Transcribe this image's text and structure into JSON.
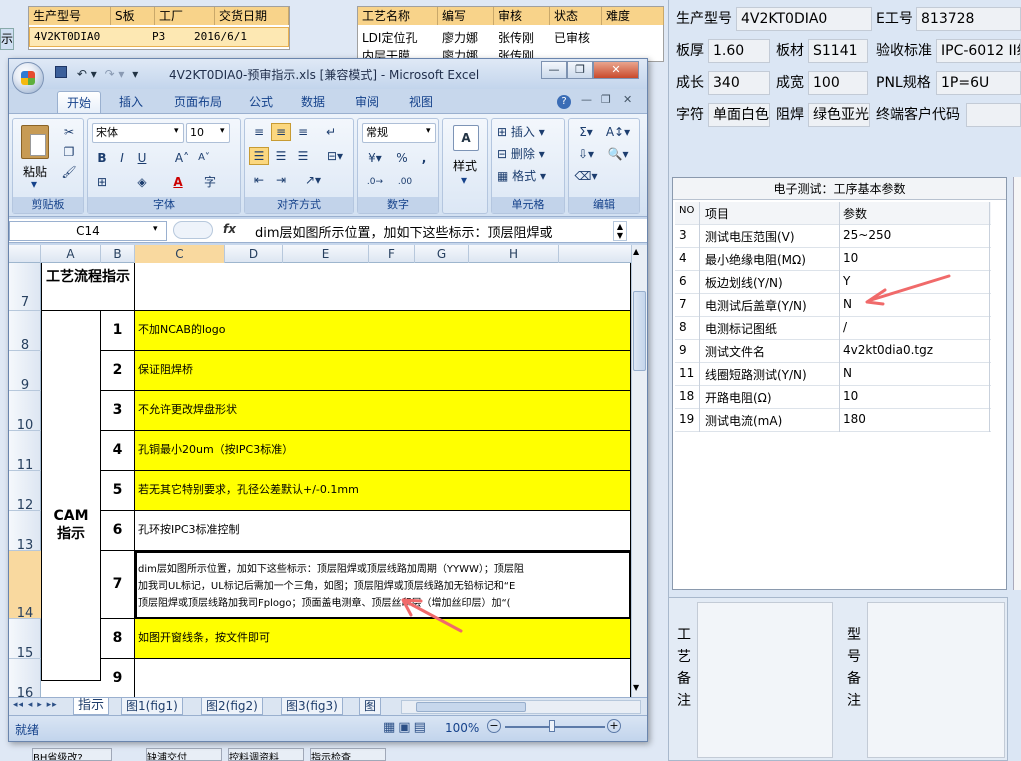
{
  "bg": {
    "left_table": {
      "headers": [
        "生产型号",
        "S板",
        "工厂",
        "交货日期"
      ],
      "row": [
        "4V2KT0DIA0",
        "P3",
        "2016/6/1"
      ]
    },
    "right_table": {
      "headers": [
        "工艺名称",
        "编写",
        "审核",
        "状态",
        "难度"
      ],
      "row": [
        "LDI定位孔",
        "廖力娜",
        "张传刚",
        "已审核"
      ],
      "row2_partial": [
        "内层干膜",
        "廖力娜",
        "张传刚"
      ]
    },
    "left_edge_text": "示",
    "bottom_buttons": [
      "BH省级改?",
      "缺浦交付",
      "控料调资料",
      "指示检查"
    ]
  },
  "panel": {
    "fields": [
      {
        "label": "生产型号",
        "value": "4V2KT0DIA0"
      },
      {
        "label": "E工号",
        "value": "813728"
      },
      {
        "label": "板厚",
        "value": "1.60"
      },
      {
        "label": "板材",
        "value": "S1141"
      },
      {
        "label": "验收标准",
        "value": "IPC-6012 II级"
      },
      {
        "label": "成长",
        "value": "340"
      },
      {
        "label": "成宽",
        "value": "100"
      },
      {
        "label": "PNL规格",
        "value": "1P=6U"
      },
      {
        "label": "字符",
        "value": "单面白色"
      },
      {
        "label": "阻焊",
        "value": "绿色亚光"
      },
      {
        "label": "终端客户代码",
        "value": ""
      }
    ],
    "params": {
      "title": "电子测试：工序基本参数",
      "headers": [
        "NO",
        "项目",
        "参数"
      ],
      "rows": [
        {
          "no": "3",
          "item": "测试电压范围(V)",
          "value": "25~250"
        },
        {
          "no": "4",
          "item": "最小绝缘电阻(MΩ)",
          "value": "10"
        },
        {
          "no": "6",
          "item": "板边划线(Y/N)",
          "value": "Y"
        },
        {
          "no": "7",
          "item": "电测试后盖章(Y/N)",
          "value": "N"
        },
        {
          "no": "8",
          "item": "电测标记图纸",
          "value": "/"
        },
        {
          "no": "9",
          "item": "测试文件名",
          "value": "4v2kt0dia0.tgz"
        },
        {
          "no": "11",
          "item": "线圈短路测试(Y/N)",
          "value": "N"
        },
        {
          "no": "18",
          "item": "开路电阻(Ω)",
          "value": "10"
        },
        {
          "no": "19",
          "item": "测试电流(mA)",
          "value": "180"
        }
      ]
    },
    "notes": {
      "left_label": "工艺备注",
      "right_label": "型号备注"
    }
  },
  "excel": {
    "title": "4V2KT0DIA0-预审指示.xls [兼容模式] - Microsoft Excel",
    "tabs": [
      "开始",
      "插入",
      "页面布局",
      "公式",
      "数据",
      "审阅",
      "视图"
    ],
    "active_tab": "开始",
    "ribbon": {
      "clipboard": {
        "label": "剪贴板",
        "paste": "粘贴"
      },
      "font": {
        "label": "字体",
        "name": "宋体",
        "size": "10"
      },
      "align": {
        "label": "对齐方式"
      },
      "number": {
        "label": "数字",
        "format": "常规"
      },
      "style": {
        "label": "样式"
      },
      "cells": {
        "label": "单元格",
        "insert": "插入",
        "delete": "删除",
        "format": "格式"
      },
      "edit": {
        "label": "编辑"
      }
    },
    "name_box": "C14",
    "formula": "dim层如图所示位置，加如下这些标示：顶层阻焊或",
    "columns": [
      "A",
      "B",
      "C",
      "D",
      "E",
      "F",
      "G",
      "H"
    ],
    "selected_column": "C",
    "rows": [
      "7",
      "8",
      "9",
      "10",
      "11",
      "12",
      "13",
      "14",
      "15",
      "16"
    ],
    "selected_row": "14",
    "a7": "工艺流程指示",
    "cam_label": "CAM 指示",
    "items": [
      {
        "n": "1",
        "text": "不加NCAB的logo"
      },
      {
        "n": "2",
        "text": "保证阻焊桥"
      },
      {
        "n": "3",
        "text": "不允许更改焊盘形状"
      },
      {
        "n": "4",
        "text": "孔铜最小20um（按IPC3标准）"
      },
      {
        "n": "5",
        "text": "若无其它特别要求，孔径公差默认+/-0.1mm"
      },
      {
        "n": "6",
        "text": "孔环按IPC3标准控制"
      },
      {
        "n": "7",
        "lines": [
          "dim层如图所示位置，加如下这些标示：顶层阻焊或顶层线路加周期（YYWW）；顶层阻",
          "加我司UL标记，UL标记后需加一个三角，如图；顶层阻焊或顶层线路加无铅标记和“E",
          "顶层阻焊或顶层线路加我司Fplogo；顶面盖电测章、顶层丝印层（增加丝印层）加“("
        ]
      },
      {
        "n": "8",
        "text": "如图开窗线条，按文件即可"
      },
      {
        "n": "9",
        "text": ""
      }
    ],
    "sheets": [
      "指示",
      "图1(fig1)",
      "图2(fig2)",
      "图3(fig3)",
      "图"
    ],
    "active_sheet": "指示",
    "status": "就绪",
    "zoom": "100%"
  },
  "colors": {
    "highlight": "#ffff00",
    "accent_arrow": "#f06a6a"
  }
}
